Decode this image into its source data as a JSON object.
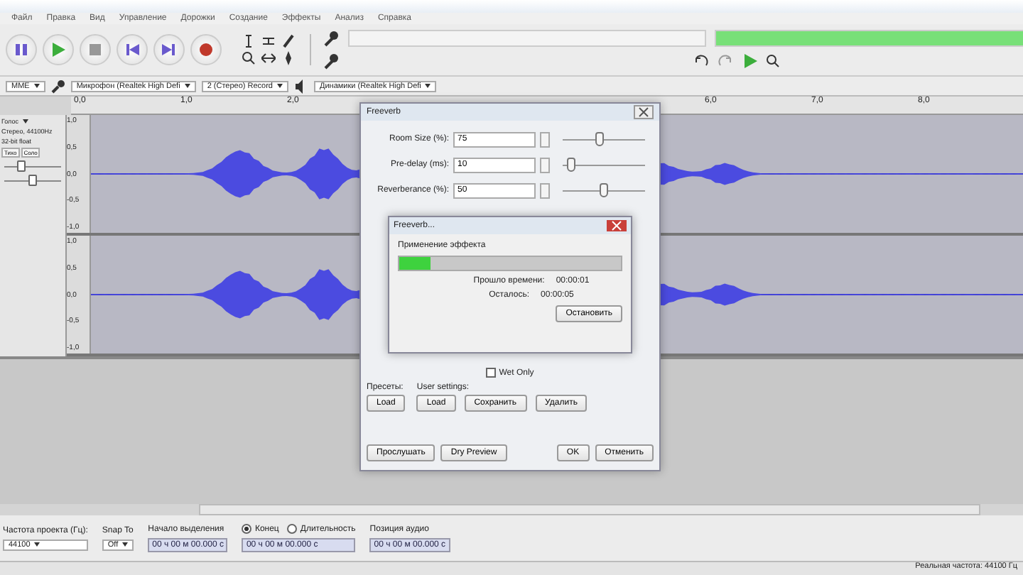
{
  "menu": [
    "Файл",
    "Правка",
    "Вид",
    "Управление",
    "Дорожки",
    "Создание",
    "Эффекты",
    "Анализ",
    "Справка"
  ],
  "devices": {
    "host": "MME",
    "input": "Микрофон (Realtek High Defi",
    "channels": "2 (Стерео) Record",
    "output": "Динамики (Realtek High Defi"
  },
  "playback_meter": {
    "level": 0.84
  },
  "ruler": {
    "left_labels": [
      "0,0",
      "1,0",
      "2,0"
    ],
    "right_labels": [
      "6,0",
      "7,0",
      "8,0"
    ]
  },
  "track": {
    "name": "Голос",
    "info": "Стерео, 44100Hz",
    "format": "32-bit float",
    "mute": "Тихо",
    "solo": "Соло",
    "gain": {
      "level": 0.3
    },
    "pan": {
      "level": 0.5
    },
    "channels": [
      {
        "scale": [
          "1,0",
          "0,5",
          "0,0",
          "-0,5",
          "-1,0"
        ]
      },
      {
        "scale": [
          "1,0",
          "0,5",
          "0,0",
          "-0,5",
          "-1,0"
        ]
      }
    ]
  },
  "effect_dialog": {
    "title": "Freeverb",
    "params": [
      {
        "label": "Room Size (%):",
        "value": "75",
        "level": 0.45
      },
      {
        "label": "Pre-delay (ms):",
        "value": "10",
        "level": 0.1
      },
      {
        "label": "Reverberance (%):",
        "value": "50",
        "level": 0.5
      }
    ],
    "wet_only": {
      "label": "Wet Only",
      "checked": false
    },
    "presets_label": "Пресеты:",
    "user_label": "User settings:",
    "preset_buttons": [
      "Load"
    ],
    "user_buttons": [
      "Load",
      "Сохранить",
      "Удалить"
    ],
    "footer_buttons": [
      "Прослушать",
      "Dry Preview",
      "OK",
      "Отменить"
    ]
  },
  "progress_dialog": {
    "title": "Freeverb...",
    "message": "Применение эффекта",
    "level": 0.14,
    "elapsed_label": "Прошло времени:",
    "elapsed": "00:00:01",
    "remaining_label": "Осталось:",
    "remaining": "00:00:05",
    "stop": "Остановить"
  },
  "selection_bar": {
    "rate_label": "Частота проекта (Гц):",
    "rate": "44100",
    "snap_label": "Snap To",
    "snap": "Off",
    "start_label": "Начало выделения",
    "end_options": [
      {
        "label": "Конец",
        "selected": true
      },
      {
        "label": "Длительность",
        "selected": false
      }
    ],
    "position_label": "Позиция аудио",
    "start": "00 ч 00 м 00.000 с",
    "end": "00 ч 00 м 00.000 с",
    "position": "00 ч 00 м 00.000 с"
  },
  "status_bar": "Реальная частота: 44100 Гц"
}
